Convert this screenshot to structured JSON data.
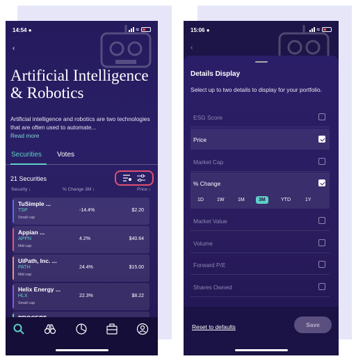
{
  "left": {
    "time": "14:54",
    "title": "Artificial Intelligence\n& Robotics",
    "description": "Artificial intelligence and robotics are two technologies that are often used to automate...",
    "read_more": "Read more",
    "tabs": [
      "Securities",
      "Votes"
    ],
    "securities_count": "21 Securities",
    "columns": {
      "security": "Security ↕",
      "change": "% Change 3M ↕",
      "price": "Price ↕"
    },
    "rows": [
      {
        "name": "TuSimple ...",
        "ticker": "TSP",
        "cap": "Small cap",
        "change": "-14.4%",
        "price": "$2.20",
        "color": "#4a78e0"
      },
      {
        "name": "Appian ...",
        "ticker": "APPN",
        "cap": "Mid cap",
        "change": "4.2%",
        "price": "$40.64",
        "color": "#e25c6f"
      },
      {
        "name": "UiPath, Inc. ...",
        "ticker": "PATH",
        "cap": "Mid cap",
        "change": "24.4%",
        "price": "$15.00",
        "color": "#e79a7a"
      },
      {
        "name": "Helix Energy ...",
        "ticker": "HLX",
        "cap": "Small cap",
        "change": "22.3%",
        "price": "$8.22",
        "color": "#8a5be0"
      },
      {
        "name": "PROCEPT ...",
        "ticker": "",
        "cap": "",
        "change": "",
        "price": "",
        "color": "#5fd0a8"
      }
    ],
    "nav_icons": [
      "search-icon",
      "binoculars-icon",
      "pie-chart-icon",
      "briefcase-icon",
      "profile-icon"
    ],
    "accent": "#5fd0c6",
    "highlight": "#e0506e"
  },
  "right": {
    "time": "15:06",
    "sheet_title": "Details Display",
    "sheet_subtitle": "Select up to two details to display for your portfolio.",
    "options_top": [
      {
        "label": "ESG Score",
        "checked": false
      },
      {
        "label": "Price",
        "checked": true
      },
      {
        "label": "Market Cap",
        "checked": false
      },
      {
        "label": "% Change",
        "checked": true
      }
    ],
    "periods": [
      "1D",
      "1W",
      "1M",
      "3M",
      "YTD",
      "1Y"
    ],
    "selected_period": "3M",
    "options_bottom": [
      {
        "label": "Market Value",
        "checked": false
      },
      {
        "label": "Volume",
        "checked": false
      },
      {
        "label": "Forward P/E",
        "checked": false
      },
      {
        "label": "Shares Owned",
        "checked": false
      }
    ],
    "reset_label": "Reset to defaults",
    "save_label": "Save"
  }
}
